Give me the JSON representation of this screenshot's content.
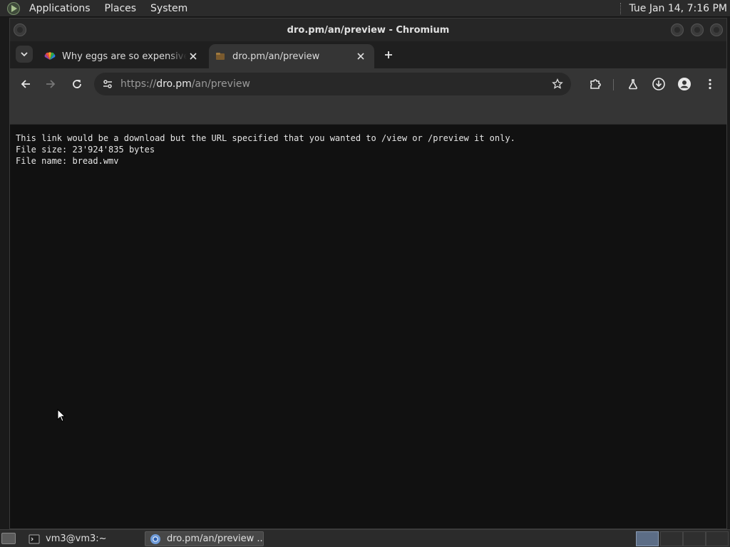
{
  "top_panel": {
    "menus": [
      "Applications",
      "Places",
      "System"
    ],
    "clock": "Tue Jan 14,  7:16 PM"
  },
  "window": {
    "title": "dro.pm/an/preview - Chromium"
  },
  "tabs": [
    {
      "title": "Why eggs are so expensive right now",
      "favicon": "nbc-peacock-icon",
      "active": false
    },
    {
      "title": "dro.pm/an/preview",
      "favicon": "page-icon",
      "active": true
    }
  ],
  "toolbar": {
    "url_scheme": "https://",
    "url_host": "dro.pm",
    "url_path": "/an/preview"
  },
  "page": {
    "lines": [
      "This link would be a download but the URL specified that you wanted to /view or /preview it only.",
      "File size: 23'924'835 bytes",
      "File name: bread.wmv"
    ]
  },
  "taskbar": {
    "tasks": [
      {
        "label": "vm3@vm3:~",
        "icon": "terminal-icon",
        "active": false
      },
      {
        "label": "dro.pm/an/preview ...",
        "icon": "chromium-icon",
        "active": true
      }
    ]
  },
  "colors": {
    "panel": "#2b2b2b",
    "page_background": "#111111",
    "toolbar": "#353535"
  }
}
